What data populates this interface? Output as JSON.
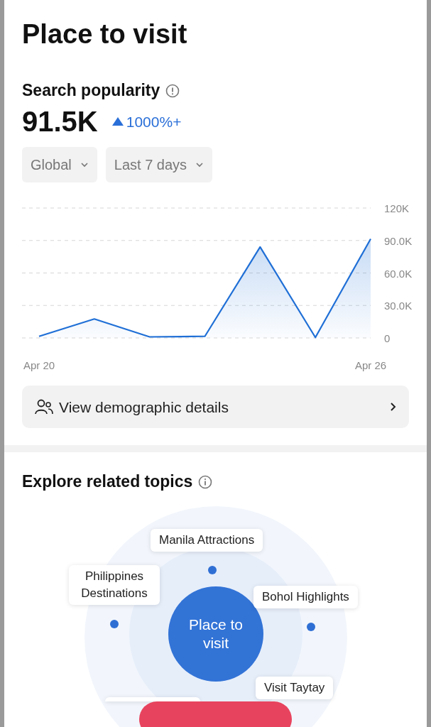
{
  "page": {
    "title": "Place to visit"
  },
  "search_popularity": {
    "heading": "Search popularity",
    "value": "91.5K",
    "change": "1000%+",
    "filters": [
      {
        "label": "Global"
      },
      {
        "label": "Last 7 days"
      }
    ],
    "chart_data": {
      "type": "area",
      "grid": true,
      "categories": [
        "Apr 20",
        null,
        null,
        null,
        null,
        null,
        "Apr 26"
      ],
      "ylim": [
        0,
        120000
      ],
      "yticks": [
        {
          "value": 0,
          "label": "0"
        },
        {
          "value": 30000,
          "label": "30.0K"
        },
        {
          "value": 60000,
          "label": "60.0K"
        },
        {
          "value": 90000,
          "label": "90.0K"
        },
        {
          "value": 120000,
          "label": "120K"
        }
      ],
      "series": [
        {
          "color": "#1f6fd6",
          "values": [
            1500,
            17500,
            1000,
            1500,
            84000,
            500,
            91500
          ]
        }
      ]
    },
    "demographics_button": "View demographic details"
  },
  "related_topics": {
    "heading": "Explore related topics",
    "center": "Place to visit",
    "topics": [
      {
        "label": "Manila Attractions"
      },
      {
        "label": "Philippines Destinations"
      },
      {
        "label": "Bohol Highlights"
      },
      {
        "label": "Visit Taytay"
      }
    ]
  }
}
